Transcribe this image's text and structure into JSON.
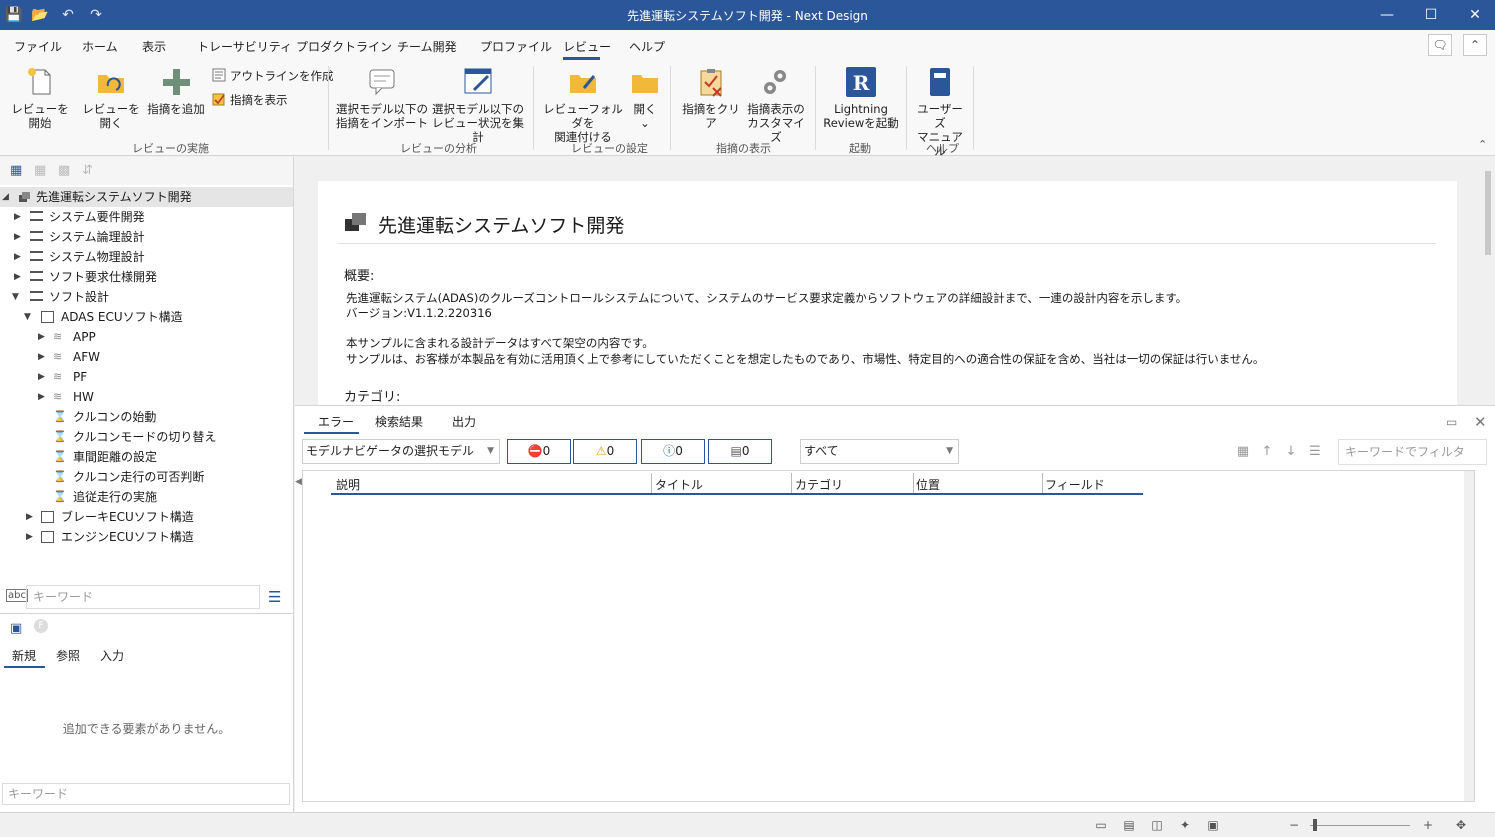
{
  "window": {
    "title": "先進運転システムソフト開発 - Next Design"
  },
  "menu": {
    "items": [
      "ファイル",
      "ホーム",
      "表示",
      "トレーサビリティ",
      "プロダクトライン",
      "チーム開発",
      "プロファイル",
      "レビュー",
      "ヘルプ"
    ],
    "active": "レビュー"
  },
  "ribbon": {
    "groups": {
      "review_exec": {
        "label": "レビューの実施",
        "start_review": "レビューを開始",
        "open_review": "レビューを開く",
        "add_comment": "指摘を追加",
        "create_outline": "アウトラインを作成",
        "show_comments": "指摘を表示"
      },
      "review_analysis": {
        "label": "レビューの分析",
        "import_1": "選択モデル以下の",
        "import_2": "指摘をインポート",
        "aggregate_1": "選択モデル以下の",
        "aggregate_2": "レビュー状況を集計"
      },
      "review_settings": {
        "label": "レビューの設定",
        "assoc_1": "レビューフォルダを",
        "assoc_2": "関連付ける",
        "open": "開く"
      },
      "comment_display": {
        "label": "指摘の表示",
        "clear": "指摘をクリア",
        "customize_1": "指摘表示の",
        "customize_2": "カスタマイズ"
      },
      "launch": {
        "label": "起動",
        "lightning_1": "Lightning",
        "lightning_2": "Reviewを起動"
      },
      "help": {
        "label": "ヘルプ",
        "manual_1": "ユーザーズ",
        "manual_2": "マニュアル"
      }
    }
  },
  "tree": {
    "root": "先進運転システムソフト開発",
    "items": [
      {
        "label": "システム要件開発"
      },
      {
        "label": "システム論理設計"
      },
      {
        "label": "システム物理設計"
      },
      {
        "label": "ソフト要求仕様開発"
      },
      {
        "label": "ソフト設計"
      },
      {
        "label": "ADAS ECUソフト構造"
      },
      {
        "label": "APP"
      },
      {
        "label": "AFW"
      },
      {
        "label": "PF"
      },
      {
        "label": "HW"
      },
      {
        "label": "クルコンの始動"
      },
      {
        "label": "クルコンモードの切り替え"
      },
      {
        "label": "車間距離の設定"
      },
      {
        "label": "クルコン走行の可否判断"
      },
      {
        "label": "追従走行の実施"
      },
      {
        "label": "ブレーキECUソフト構造"
      },
      {
        "label": "エンジンECUソフト構造"
      }
    ]
  },
  "left_panel": {
    "keyword_placeholder": "キーワード",
    "tabs": [
      "新規",
      "参照",
      "入力"
    ],
    "empty_message": "追加できる要素がありません。",
    "keyword2_placeholder": "キーワード"
  },
  "document": {
    "title": "先進運転システムソフト開発",
    "overview_heading": "概要:",
    "line1": "先進運転システム(ADAS)のクルーズコントロールシステムについて、システムのサービス要求定義からソフトウェアの詳細設計まで、一連の設計内容を示します。",
    "line2": "バージョン:V1.1.2.220316",
    "line3": "本サンプルに含まれる設計データはすべて架空の内容です。",
    "line4": "サンプルは、お客様が本製品を有効に活用頂く上で参考にしていただくことを想定したものであり、市場性、特定目的への適合性の保証を含め、当社は一切の保証は行いません。",
    "category_heading": "カテゴリ:"
  },
  "bottom_panel": {
    "tabs": [
      "エラー",
      "検索結果",
      "出力"
    ],
    "scope": "モデルナビゲータの選択モデル",
    "counts": {
      "error": "0",
      "warning": "0",
      "info": "0",
      "other": "0"
    },
    "level": "すべて",
    "filter_placeholder": "キーワードでフィルタ",
    "columns": [
      "説明",
      "タイトル",
      "カテゴリ",
      "位置",
      "フィールド"
    ]
  },
  "colors": {
    "accent": "#2b579a",
    "title_bar": "#2b579a"
  }
}
